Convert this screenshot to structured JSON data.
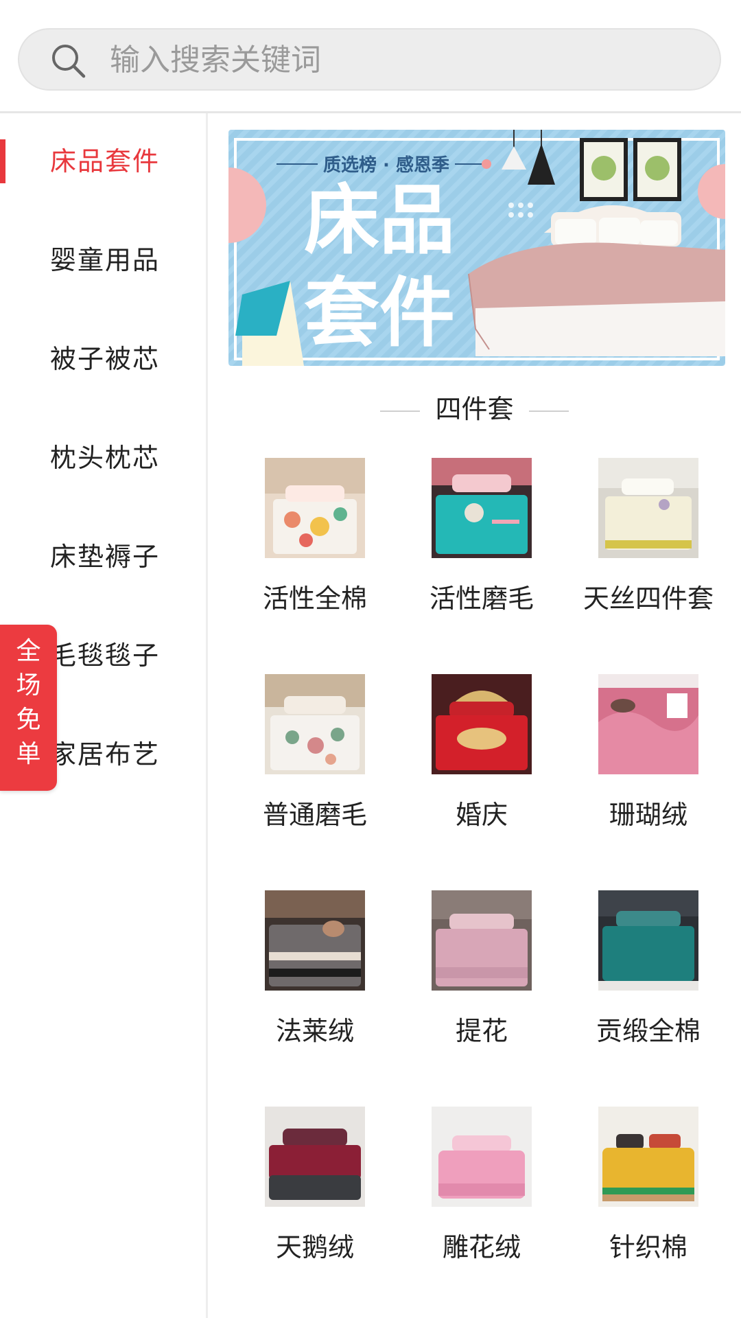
{
  "search": {
    "placeholder": "输入搜索关键词"
  },
  "sidebar": {
    "items": [
      {
        "label": "床品套件",
        "active": true
      },
      {
        "label": "婴童用品"
      },
      {
        "label": "被子被芯"
      },
      {
        "label": "枕头枕芯"
      },
      {
        "label": "床垫褥子"
      },
      {
        "label": "毛毯毯子"
      },
      {
        "label": "家居布艺"
      }
    ]
  },
  "badge": {
    "chars": [
      "全",
      "场",
      "免",
      "单"
    ]
  },
  "banner": {
    "tagline": "质选榜 · 感恩季",
    "title_line1": "床品",
    "title_line2": "套件"
  },
  "section": {
    "title": "四件套"
  },
  "grid": {
    "items": [
      {
        "label": "活性全棉"
      },
      {
        "label": "活性磨毛"
      },
      {
        "label": "天丝四件套"
      },
      {
        "label": "普通磨毛"
      },
      {
        "label": "婚庆"
      },
      {
        "label": "珊瑚绒"
      },
      {
        "label": "法莱绒"
      },
      {
        "label": "提花"
      },
      {
        "label": "贡缎全棉"
      },
      {
        "label": "天鹅绒"
      },
      {
        "label": "雕花绒"
      },
      {
        "label": "针织棉"
      }
    ]
  },
  "colors": {
    "accent": "#e8383d",
    "badge": "#ec3b40",
    "banner_bg": "#9ccde8"
  }
}
